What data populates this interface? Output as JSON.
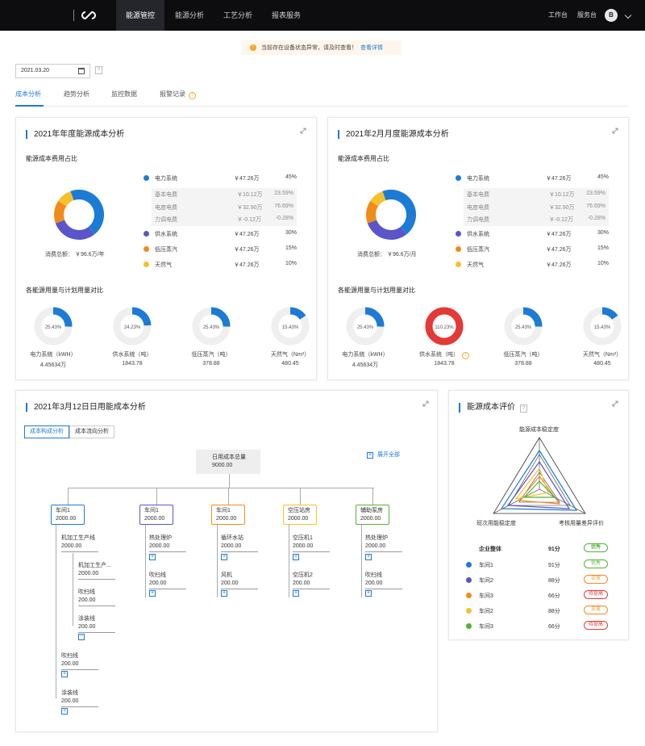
{
  "nav": {
    "items": [
      "能源管控",
      "能源分析",
      "工艺分析",
      "报表服务"
    ],
    "right": [
      "工作台",
      "服务台"
    ],
    "avatar": "B"
  },
  "alert": {
    "text": "当前存在设备状态异常，请及时查看！",
    "link": "查看详情",
    "icon": "!"
  },
  "date": {
    "value": "2021.03.20",
    "help": "?"
  },
  "tabs": [
    "成本分析",
    "趋势分析",
    "监控数据",
    "报警记录"
  ],
  "colors": {
    "blue": "#1c7bd4",
    "purple": "#5a55c9",
    "orange": "#f08c1a",
    "yellow": "#f6c02c",
    "green": "#52b234",
    "red": "#e53935"
  },
  "annual": {
    "title": "2021年年度能源成本分析",
    "pie_title": "能源成本费用占比",
    "total": "消费总额： ￥96.6万/年",
    "compare_title": "各能源用量与计划用量对比"
  },
  "monthly": {
    "title": "2021年2月月度能源成本分析",
    "pie_title": "能源成本费用占比",
    "total": "消费总额： ￥96.6万/月",
    "compare_title": "各能源用量与计划用量对比"
  },
  "cost_legend": [
    {
      "name": "电力系统",
      "value": "￥47.26万",
      "pct": "45%",
      "color": "#1c7bd4"
    },
    {
      "name": "供水系统",
      "value": "￥47.26万",
      "pct": "30%",
      "color": "#5a55c9"
    },
    {
      "name": "低压蒸汽",
      "value": "￥47.26万",
      "pct": "15%",
      "color": "#f08c1a"
    },
    {
      "name": "天然气",
      "value": "￥47.26万",
      "pct": "10%",
      "color": "#f6c02c"
    }
  ],
  "cost_sub": [
    {
      "name": "基本电费",
      "value": "￥10.12万",
      "pct": "23.59%"
    },
    {
      "name": "电度电费",
      "value": "￥32.90万",
      "pct": "76.69%"
    },
    {
      "name": "力调电费",
      "value": "￥-0.12万",
      "pct": "-0.28%"
    }
  ],
  "annual_gauges": [
    {
      "pct": "25.43%",
      "fraction": 0.2543,
      "label": "电力系统（kWH）",
      "value": "4.45634万",
      "color": "#1c7bd4"
    },
    {
      "pct": "24.23%",
      "fraction": 0.2423,
      "label": "供水系统（吨）",
      "value": "1843.78",
      "color": "#1c7bd4"
    },
    {
      "pct": "25.43%",
      "fraction": 0.2543,
      "label": "低压蒸汽（吨）",
      "value": "378.88",
      "color": "#1c7bd4"
    },
    {
      "pct": "15.43%",
      "fraction": 0.1543,
      "label": "天然气（Nm³）",
      "value": "480.45",
      "color": "#1c7bd4"
    }
  ],
  "monthly_gauges": [
    {
      "pct": "25.43%",
      "fraction": 0.2543,
      "label": "电力系统（kWH）",
      "value": "4.45634万",
      "color": "#1c7bd4"
    },
    {
      "pct": "110.23%",
      "fraction": 1.0,
      "label": "供水系统（吨）",
      "value": "1843.78",
      "color": "#e53935",
      "warn": true
    },
    {
      "pct": "25.43%",
      "fraction": 0.2543,
      "label": "低压蒸汽（吨）",
      "value": "378.88",
      "color": "#1c7bd4"
    },
    {
      "pct": "15.43%",
      "fraction": 0.1543,
      "label": "天然气（Nm³）",
      "value": "480.45",
      "color": "#1c7bd4"
    }
  ],
  "daily": {
    "title": "2021年3月12日日用能成本分析",
    "btn_a": "成本构成分析",
    "btn_b": "成本流向分析",
    "expand_all": "展开全部",
    "root_label": "日用成本总量",
    "root_value": "9000.00",
    "workshops": [
      {
        "name": "车间1",
        "value": "2000.00",
        "color": "#1c7bd4"
      },
      {
        "name": "车间1",
        "value": "2000.00",
        "color": "#5a55c9"
      },
      {
        "name": "车间1",
        "value": "2000.00",
        "color": "#f08c1a"
      },
      {
        "name": "空压站房",
        "value": "2000.00",
        "color": "#f6c02c"
      },
      {
        "name": "辅助泵房",
        "value": "2000.00",
        "color": "#52b234"
      }
    ],
    "nodes": [
      {
        "name": "机加工生产线",
        "value": "2000.00"
      },
      {
        "name": "机加工生产...",
        "value": "2000.00"
      },
      {
        "name": "吹扫线",
        "value": "200.00"
      },
      {
        "name": "涂装线",
        "value": "200.00"
      },
      {
        "name": "吹扫线",
        "value": "200.00"
      },
      {
        "name": "涂装线",
        "value": "200.00"
      },
      {
        "name": "热处理炉",
        "value": "2000.00"
      },
      {
        "name": "吹扫线",
        "value": "200.00"
      },
      {
        "name": "循环水站",
        "value": "2000.00"
      },
      {
        "name": "风机",
        "value": "200.00"
      },
      {
        "name": "空压机1",
        "value": "2000.00"
      },
      {
        "name": "空压机2",
        "value": "200.00"
      },
      {
        "name": "热处理炉",
        "value": "2000.00"
      },
      {
        "name": "吹扫线",
        "value": "200.00"
      }
    ]
  },
  "evaluation": {
    "title": "能源成本评价",
    "help": "?",
    "axes": [
      "能源成本稳定度",
      "考核用量差异评价",
      "班次用能稳定度"
    ],
    "header": {
      "name": "企业整体",
      "score": "91分",
      "grade": "优秀"
    },
    "rows": [
      {
        "name": "车间1",
        "score": "91分",
        "grade": "优秀",
        "color": "#1c7bd4",
        "grade_color": "#52b234"
      },
      {
        "name": "车间2",
        "score": "88分",
        "grade": "正常",
        "color": "#5a55c9",
        "grade_color": "#f08c1a"
      },
      {
        "name": "车间3",
        "score": "66分",
        "grade": "待提高",
        "color": "#f08c1a",
        "grade_color": "#e53935"
      },
      {
        "name": "车间2",
        "score": "88分",
        "grade": "正常",
        "color": "#f6c02c",
        "grade_color": "#f08c1a"
      },
      {
        "name": "车间3",
        "score": "66分",
        "grade": "待提高",
        "color": "#52b234",
        "grade_color": "#e53935"
      }
    ]
  }
}
